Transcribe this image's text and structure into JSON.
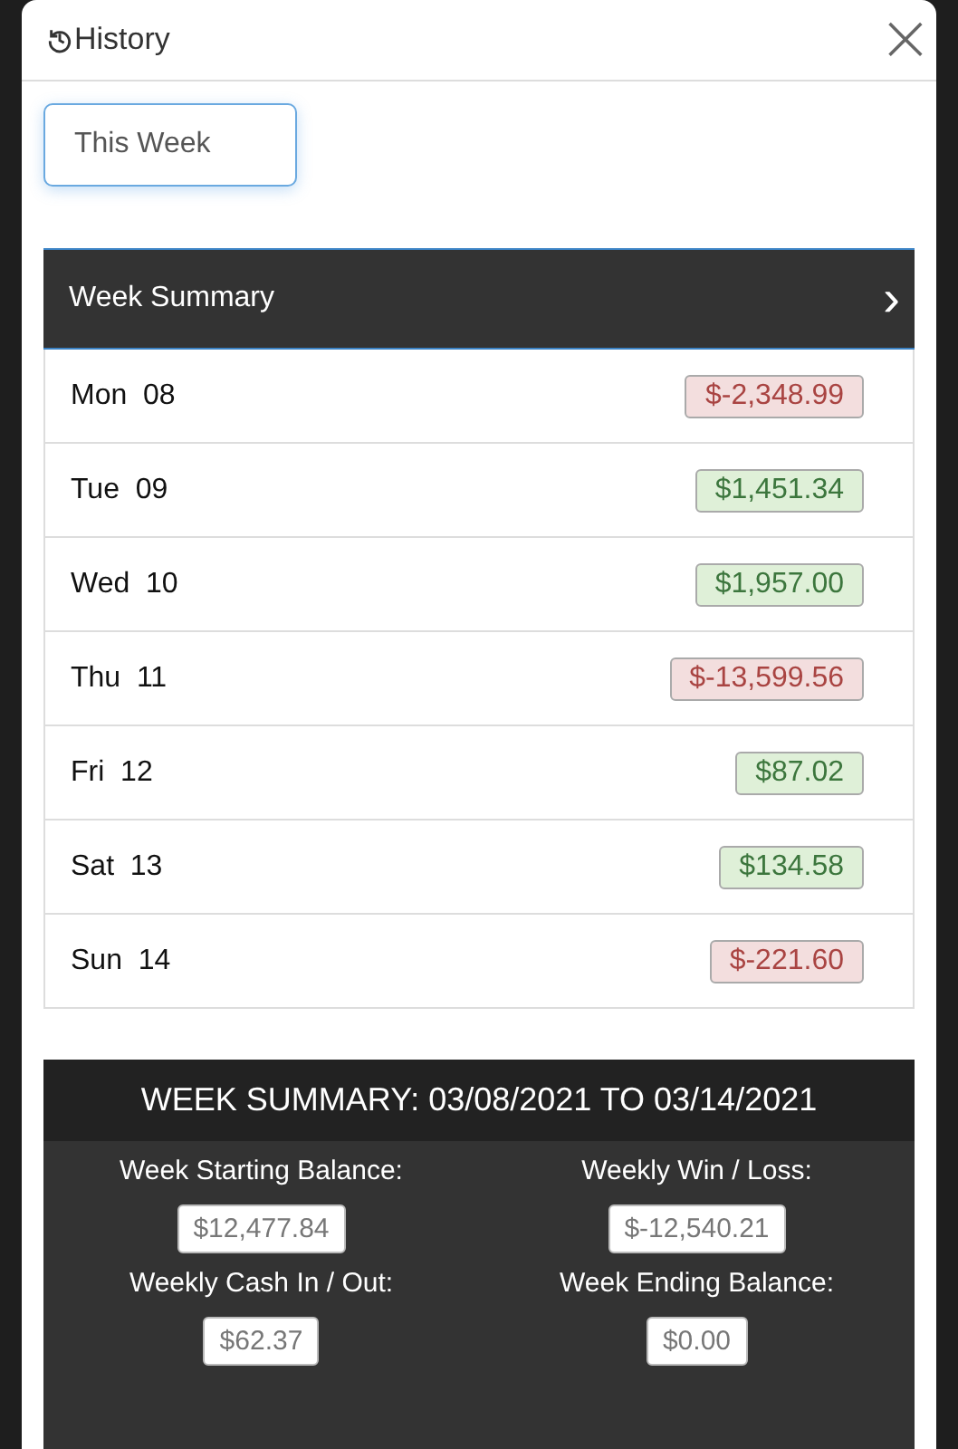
{
  "dialog": {
    "title": "History",
    "close": "×"
  },
  "period_field": {
    "value": "This Week"
  },
  "summary_header": {
    "label": "Week Summary",
    "chevron": "›"
  },
  "days": [
    {
      "label": "Mon  08",
      "amount": "$-2,348.99",
      "kind": "loss"
    },
    {
      "label": "Tue  09",
      "amount": "$1,451.34",
      "kind": "gain"
    },
    {
      "label": "Wed  10",
      "amount": "$1,957.00",
      "kind": "gain"
    },
    {
      "label": "Thu  11",
      "amount": "$-13,599.56",
      "kind": "loss"
    },
    {
      "label": "Fri  12",
      "amount": "$87.02",
      "kind": "gain"
    },
    {
      "label": "Sat  13",
      "amount": "$134.58",
      "kind": "gain"
    },
    {
      "label": "Sun  14",
      "amount": "$-221.60",
      "kind": "loss"
    }
  ],
  "week_summary": {
    "title": "WEEK SUMMARY: 03/08/2021 TO 03/14/2021",
    "stats": [
      {
        "label": "Week Starting Balance:",
        "value": "$12,477.84"
      },
      {
        "label": "Weekly Win / Loss:",
        "value": "$-12,540.21"
      },
      {
        "label": "Weekly Cash In / Out:",
        "value": "$62.37"
      },
      {
        "label": "Week Ending Balance:",
        "value": "$0.00"
      }
    ]
  }
}
